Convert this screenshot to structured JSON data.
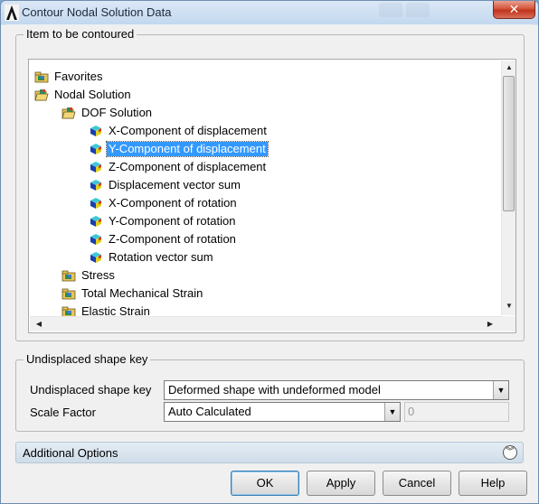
{
  "window": {
    "title": "Contour Nodal Solution Data",
    "close_label": "✕",
    "app_icon": "ansys-icon"
  },
  "item_group": {
    "legend": "Item to be contoured",
    "tree": [
      {
        "label": "Favorites",
        "level": 0,
        "icon": "folder-icon",
        "selected": false
      },
      {
        "label": "Nodal Solution",
        "level": 0,
        "icon": "folder-open-icon",
        "selected": false
      },
      {
        "label": "DOF Solution",
        "level": 1,
        "icon": "folder-open-icon",
        "selected": false
      },
      {
        "label": "X-Component of displacement",
        "level": 2,
        "icon": "result-cube-icon",
        "selected": false
      },
      {
        "label": "Y-Component of displacement",
        "level": 2,
        "icon": "result-cube-icon",
        "selected": true
      },
      {
        "label": "Z-Component of displacement",
        "level": 2,
        "icon": "result-cube-icon",
        "selected": false
      },
      {
        "label": "Displacement vector sum",
        "level": 2,
        "icon": "result-cube-icon",
        "selected": false
      },
      {
        "label": "X-Component of rotation",
        "level": 2,
        "icon": "result-cube-icon",
        "selected": false
      },
      {
        "label": "Y-Component of rotation",
        "level": 2,
        "icon": "result-cube-icon",
        "selected": false
      },
      {
        "label": "Z-Component of rotation",
        "level": 2,
        "icon": "result-cube-icon",
        "selected": false
      },
      {
        "label": "Rotation vector sum",
        "level": 2,
        "icon": "result-cube-icon",
        "selected": false
      },
      {
        "label": "Stress",
        "level": 1,
        "icon": "folder-icon",
        "selected": false
      },
      {
        "label": "Total Mechanical Strain",
        "level": 1,
        "icon": "folder-icon",
        "selected": false
      },
      {
        "label": "Elastic Strain",
        "level": 1,
        "icon": "folder-icon",
        "selected": false
      }
    ]
  },
  "shape_group": {
    "legend": "Undisplaced shape key",
    "key_label": "Undisplaced shape key",
    "key_value": "Deformed shape with undeformed model",
    "scale_label": "Scale Factor",
    "scale_value": "Auto Calculated",
    "scale_input_value": "0"
  },
  "additional": {
    "label": "Additional Options"
  },
  "buttons": {
    "ok": "OK",
    "apply": "Apply",
    "cancel": "Cancel",
    "help": "Help"
  },
  "colors": {
    "selection": "#3399ff",
    "title_gradient_top": "#dbe8f6",
    "close_button": "#c0321c"
  }
}
